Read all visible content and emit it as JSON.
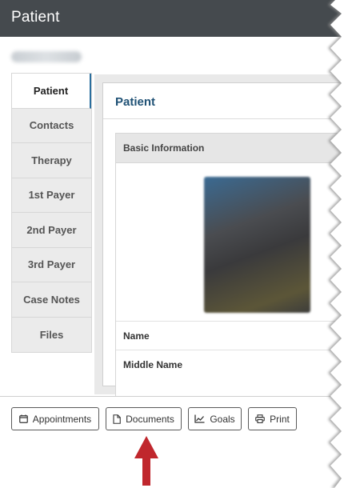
{
  "header": {
    "title": "Patient"
  },
  "tabs": [
    {
      "label": "Patient",
      "active": true
    },
    {
      "label": "Contacts",
      "active": false
    },
    {
      "label": "Therapy",
      "active": false
    },
    {
      "label": "1st Payer",
      "active": false
    },
    {
      "label": "2nd Payer",
      "active": false
    },
    {
      "label": "3rd Payer",
      "active": false
    },
    {
      "label": "Case Notes",
      "active": false
    },
    {
      "label": "Files",
      "active": false
    }
  ],
  "main": {
    "title": "Patient",
    "panel": {
      "header": "Basic Information",
      "fields": [
        {
          "label": "Name"
        },
        {
          "label": "Middle Name"
        }
      ]
    }
  },
  "actions": [
    {
      "label": "Appointments",
      "icon": "calendar-icon"
    },
    {
      "label": "Documents",
      "icon": "document-icon"
    },
    {
      "label": "Goals",
      "icon": "chart-icon"
    },
    {
      "label": "Print",
      "icon": "printer-icon"
    }
  ],
  "colors": {
    "header_bg": "#454a4e",
    "accent": "#1f5175",
    "arrow": "#c0272d"
  }
}
